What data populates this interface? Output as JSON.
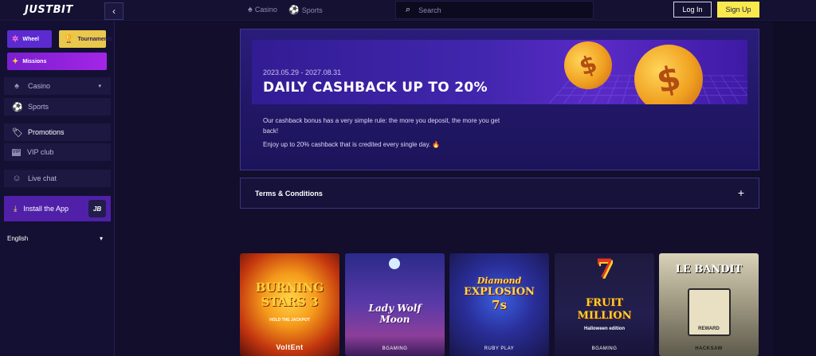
{
  "header": {
    "logo": "JUSTBIT",
    "collapse_icon": "chevron-left-icon",
    "nav": [
      {
        "label": "Casino",
        "icon": "spade-icon"
      },
      {
        "label": "Sports",
        "icon": "soccer-ball-icon"
      }
    ],
    "search_placeholder": "Search",
    "login_label": "Log In",
    "signup_label": "Sign Up"
  },
  "sidebar": {
    "tiles": [
      {
        "label": "Wheel",
        "icon": "wheel-icon"
      },
      {
        "label": "Tournaments",
        "icon": "trophy-icon"
      },
      {
        "label": "Missions",
        "icon": "missions-icon"
      }
    ],
    "items": [
      {
        "label": "Casino",
        "icon": "spade-icon",
        "chevron": "▾"
      },
      {
        "label": "Sports",
        "icon": "soccer-ball-icon"
      },
      {
        "label": "Promotions",
        "icon": "tag-icon"
      },
      {
        "label": "VIP club",
        "icon": "vip-icon"
      },
      {
        "label": "Live chat",
        "icon": "headset-icon"
      }
    ],
    "install": {
      "label": "Install the App",
      "badge": "JB",
      "icon": "download-icon"
    },
    "language": {
      "label": "English",
      "chevron": "▾"
    }
  },
  "promo": {
    "dates": "2023.05.29 - 2027.08.31",
    "title": "DAILY CASHBACK UP TO 20%",
    "description_lines": [
      "Our cashback bonus has a very simple rule: the more you deposit, the more you get",
      "back!",
      "Enjoy up to 20% cashback that is credited every single day. 🔥"
    ],
    "coin_symbol": "$"
  },
  "terms": {
    "label": "Terms & Conditions",
    "toggle": "+"
  },
  "games": [
    {
      "title_lines": [
        "BURNING",
        "STARS 3"
      ],
      "tagline": "HOLD THE JACKPOT",
      "provider": "VoltEnt",
      "name_color": "#ffd23a"
    },
    {
      "title_lines": [
        "Lady Wolf",
        "Moon"
      ],
      "tagline": "",
      "provider": "BGAMING",
      "name_color": "#ffffff"
    },
    {
      "title_lines": [
        "Diamond",
        "EXPLOSION",
        "7s"
      ],
      "tagline": "",
      "provider": "RUBY PLAY",
      "name_color": "#ffd84a"
    },
    {
      "title_lines": [
        "FRUIT",
        "MILLION"
      ],
      "tagline": "Halloween edition",
      "provider": "BGAMING",
      "name_color": "#ffcf2e"
    },
    {
      "title_lines": [
        "LE BANDIT"
      ],
      "tagline": "REWARD",
      "provider": "HACKSAW",
      "name_color": "#ffffff"
    }
  ]
}
